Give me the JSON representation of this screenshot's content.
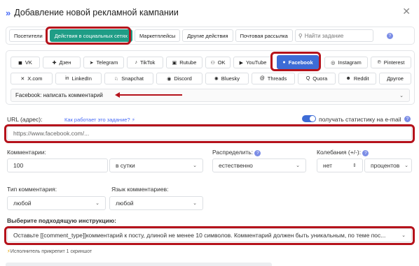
{
  "header": {
    "title": "Добавление новой рекламной кампании",
    "icon": "double-chevron-right-icon",
    "close": "✕"
  },
  "tabs": [
    {
      "label": "Посетители",
      "active": false
    },
    {
      "label": "Действия в социальных сетях",
      "active": true
    },
    {
      "label": "Маркетплейсы",
      "active": false
    },
    {
      "label": "Другие действия",
      "active": false
    },
    {
      "label": "Почтовая рассылка",
      "active": false
    }
  ],
  "search": {
    "placeholder": "Найти задание"
  },
  "help_badge": "?",
  "networks": [
    {
      "label": "VK",
      "icon": "◼",
      "active": false
    },
    {
      "label": "Дзен",
      "icon": "✚",
      "active": false
    },
    {
      "label": "Telegram",
      "icon": "➤",
      "active": false
    },
    {
      "label": "TikTok",
      "icon": "♪",
      "active": false
    },
    {
      "label": "Rutube",
      "icon": "▣",
      "active": false
    },
    {
      "label": "OK",
      "icon": "⚇",
      "active": false
    },
    {
      "label": "YouTube",
      "icon": "▶",
      "active": false
    },
    {
      "label": "Facebook",
      "icon": "●",
      "active": true
    },
    {
      "label": "Instagram",
      "icon": "◎",
      "active": false
    },
    {
      "label": "Pinterest",
      "icon": "℗",
      "active": false
    },
    {
      "label": "X.com",
      "icon": "✕",
      "active": false
    },
    {
      "label": "LinkedIn",
      "icon": "in",
      "active": false
    },
    {
      "label": "Snapchat",
      "icon": "♘",
      "active": false
    },
    {
      "label": "Discord",
      "icon": "◉",
      "active": false
    },
    {
      "label": "Bluesky",
      "icon": "✺",
      "active": false
    },
    {
      "label": "Threads",
      "icon": "@",
      "active": false
    },
    {
      "label": "Quora",
      "icon": "Q",
      "active": false
    },
    {
      "label": "Reddit",
      "icon": "☻",
      "active": false
    },
    {
      "label": "Другое",
      "icon": "",
      "active": false
    }
  ],
  "task_select": {
    "value": "Facebook: написать комментарий"
  },
  "url": {
    "label": "URL (адрес):",
    "help_link": "Как работает это задание?",
    "placeholder": "https://www.facebook.com/...",
    "stats_label": "получать статистику на e-mail",
    "stats_enabled": true
  },
  "comments": {
    "label": "Комментарии:",
    "value": "100",
    "period": "в сутки"
  },
  "distribute": {
    "label": "Распределить:",
    "value": "естественно"
  },
  "fluctuation": {
    "label": "Колебания (+/-):",
    "value": "нет",
    "unit": "процентов"
  },
  "comment_type": {
    "label": "Тип комментария:",
    "value": "любой"
  },
  "comment_lang": {
    "label": "Язык комментариев:",
    "value": "любой"
  },
  "instruction": {
    "label": "Выберите подходящую инструкцию:",
    "value": "Оставьте [[comment_type]]комментарий к посту, длиной не менее 10 символов. Комментарий должен быть уникальным, по теме пос..."
  },
  "screenshot_note": "Исполнитель прикрепит 1 скриншот",
  "colors": {
    "accent": "#3d6cd6",
    "active_tab": "#1f9d86",
    "highlight": "#b5121b"
  }
}
